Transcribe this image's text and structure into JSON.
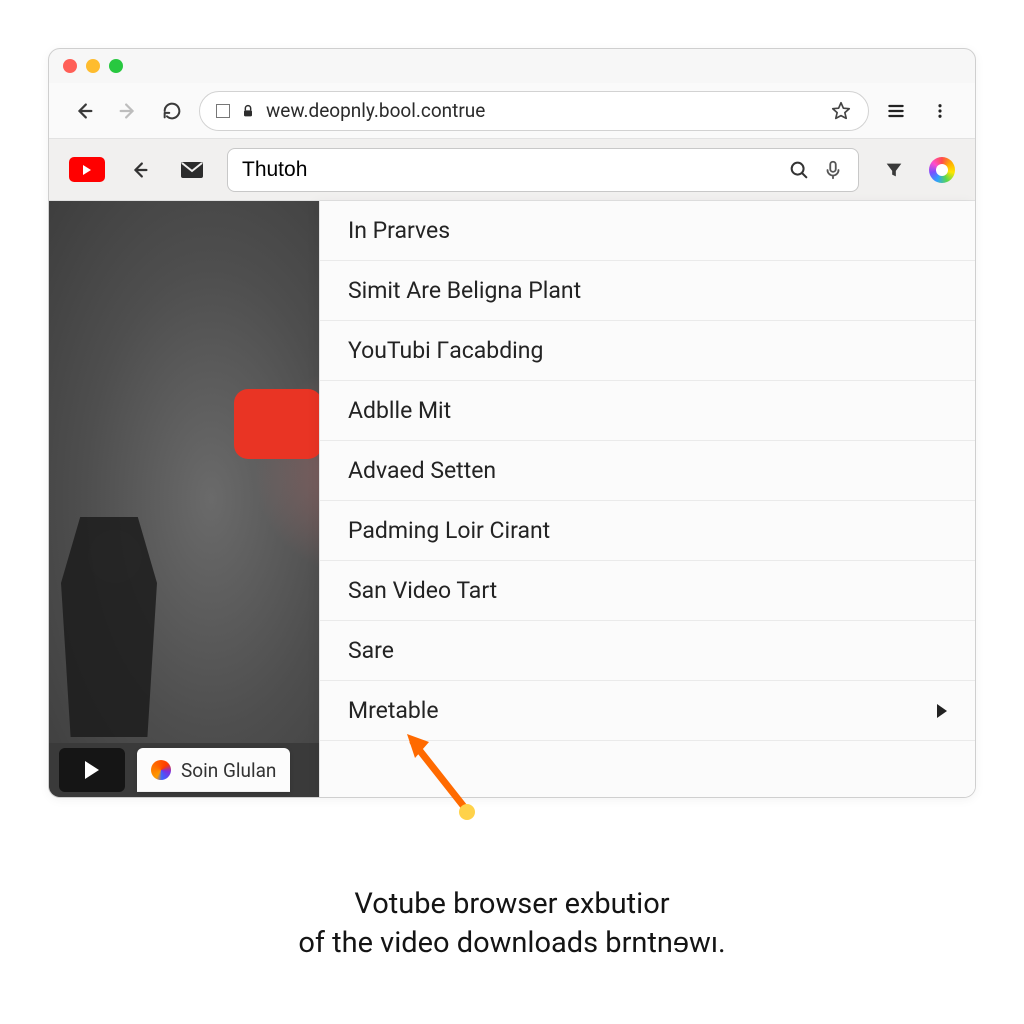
{
  "address_bar": {
    "url_text": "wew.deopnly.bool.contrue"
  },
  "toolbar": {
    "search_value": "Thutoh"
  },
  "dropdown": {
    "items": [
      "In Prarves",
      "Simit Are Beligna Plant",
      "YouTubi Гacabding",
      "Adblle Mit",
      "Advaed Setten",
      "Padming Loir Cirant",
      "San Video Tart",
      "Sare",
      "Mretable"
    ]
  },
  "bottom_tab": {
    "label": "Soin Glulan"
  },
  "caption": {
    "line1": "Votube browser exbutior",
    "line2": "of the video downloads brntnɘwı."
  }
}
